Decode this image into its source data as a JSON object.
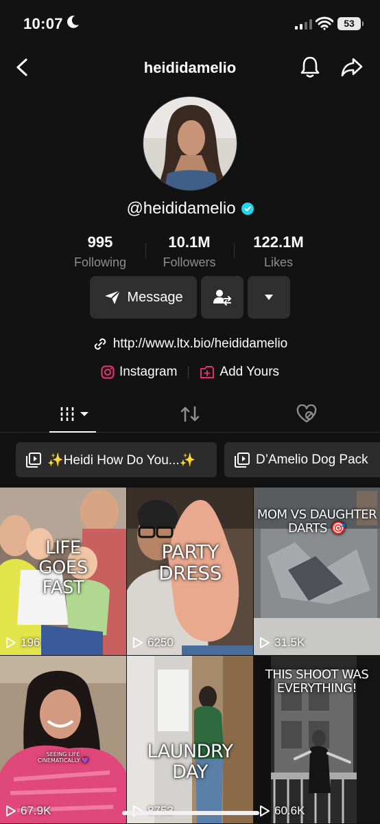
{
  "status_bar": {
    "time": "10:07",
    "battery": "53"
  },
  "header": {
    "title": "heididamelio"
  },
  "profile": {
    "handle": "@heididamelio"
  },
  "stats": [
    {
      "value": "995",
      "label": "Following"
    },
    {
      "value": "10.1M",
      "label": "Followers"
    },
    {
      "value": "122.1M",
      "label": "Likes"
    }
  ],
  "actions": {
    "message_label": "Message"
  },
  "bio": {
    "link": "http://www.ltx.bio/heididamelio"
  },
  "socials": [
    {
      "label": "Instagram"
    },
    {
      "label": "Add Yours"
    }
  ],
  "playlists": [
    {
      "label": "✨Heidi How Do You...✨"
    },
    {
      "label": "D’Amelio Dog Pack"
    }
  ],
  "videos": [
    {
      "caption": "LIFE\nGOES\nFAST",
      "views": "196"
    },
    {
      "caption": "PARTY\nDRESS",
      "views": "6250"
    },
    {
      "caption": "MOM VS DAUGHTER\nDARTS 🎯",
      "views": "31.5K"
    },
    {
      "caption": "SEEING LIFE\nCINEMATICALLY 💜",
      "views": "67.9K"
    },
    {
      "caption": "LAUNDRY\nDAY",
      "views": "8753"
    },
    {
      "caption": "THIS SHOOT WAS\nEVERYTHING!",
      "views": "60.6K"
    }
  ],
  "colors": {
    "background": "#121212",
    "button": "#2f2f2f",
    "verified": "#20d5ec",
    "instagram": "#e1306c",
    "muted": "#8e8e8e"
  }
}
